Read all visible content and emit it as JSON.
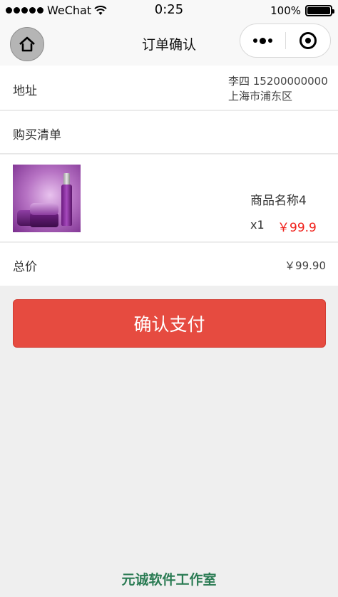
{
  "status_bar": {
    "carrier": "WeChat",
    "time": "0:25",
    "battery": "100%",
    "battery_level": 1.0
  },
  "nav": {
    "title": "订单确认",
    "icons": {
      "home": "home-icon",
      "more": "more-dots-icon",
      "close": "target-close-icon"
    }
  },
  "address": {
    "label": "地址",
    "contact": "李四 15200000000",
    "location": "上海市浦东区"
  },
  "shopping_list": {
    "label": "购买清单"
  },
  "item": {
    "name": "商品名称4",
    "quantity": "x1",
    "price": "￥99.9"
  },
  "total": {
    "label": "总价",
    "value": "￥99.90"
  },
  "pay_button": {
    "label": "确认支付"
  },
  "footer": {
    "text": "元诚软件工作室"
  },
  "colors": {
    "accent": "#e64b40",
    "price": "#f0201a",
    "footer": "#2a7b53"
  }
}
